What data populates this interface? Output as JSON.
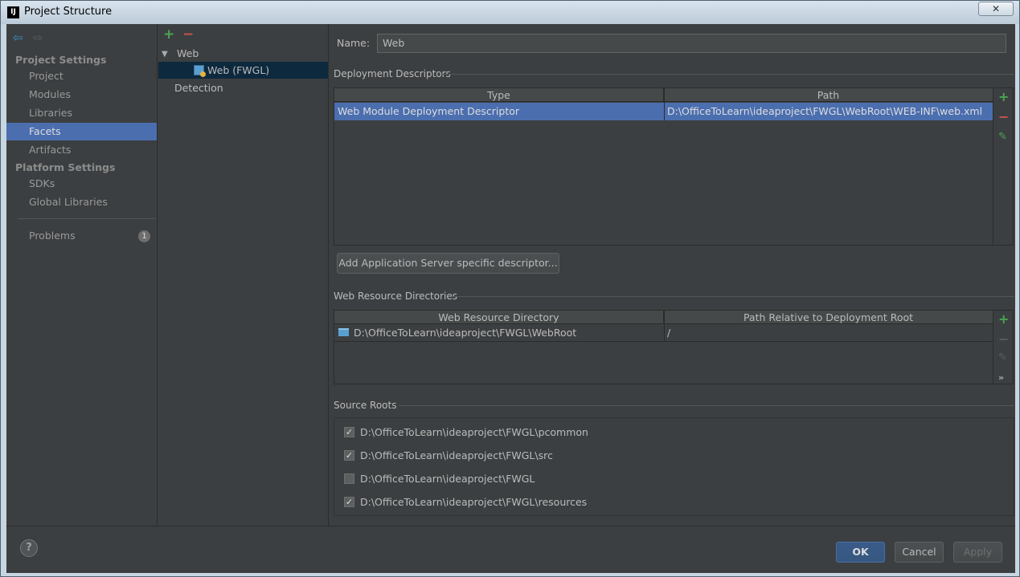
{
  "window": {
    "title": "Project Structure",
    "app_icon": "IJ",
    "close_glyph": "✕"
  },
  "nav": {
    "back_icon": "⇦",
    "forward_icon": "⇨",
    "project_settings_title": "Project Settings",
    "project_items": [
      "Project",
      "Modules",
      "Libraries",
      "Facets",
      "Artifacts"
    ],
    "selected": "Facets",
    "platform_settings_title": "Platform Settings",
    "platform_items": [
      "SDKs",
      "Global Libraries"
    ],
    "problems_label": "Problems",
    "problems_count": "1"
  },
  "tree": {
    "add_icon": "+",
    "remove_icon": "−",
    "root_label": "Web",
    "child_label": "Web (FWGL)",
    "detection_label": "Detection"
  },
  "facet": {
    "name_label": "Name:",
    "name_value": "Web",
    "deployment": {
      "title": "Deployment Descriptors",
      "columns": [
        "Type",
        "Path"
      ],
      "rows": [
        {
          "type": "Web Module Deployment Descriptor",
          "path": "D:\\OfficeToLearn\\ideaproject\\FWGL\\WebRoot\\WEB-INF\\web.xml"
        }
      ],
      "add_server_button": "Add Application Server specific descriptor..."
    },
    "resources": {
      "title": "Web Resource Directories",
      "columns": [
        "Web Resource Directory",
        "Path Relative to Deployment Root"
      ],
      "rows": [
        {
          "dir": "D:\\OfficeToLearn\\ideaproject\\FWGL\\WebRoot",
          "relative": "/"
        }
      ]
    },
    "source_roots": {
      "title": "Source Roots",
      "items": [
        {
          "path": "D:\\OfficeToLearn\\ideaproject\\FWGL\\pcommon",
          "checked": true
        },
        {
          "path": "D:\\OfficeToLearn\\ideaproject\\FWGL\\src",
          "checked": true
        },
        {
          "path": "D:\\OfficeToLearn\\ideaproject\\FWGL",
          "checked": false
        },
        {
          "path": "D:\\OfficeToLearn\\ideaproject\\FWGL\\resources",
          "checked": true
        }
      ]
    }
  },
  "footer": {
    "help": "?",
    "ok": "OK",
    "cancel": "Cancel",
    "apply": "Apply"
  },
  "colors": {
    "selection": "#4b6eaf",
    "add": "#49a552",
    "remove": "#c75450",
    "panel": "#3c3f41"
  }
}
